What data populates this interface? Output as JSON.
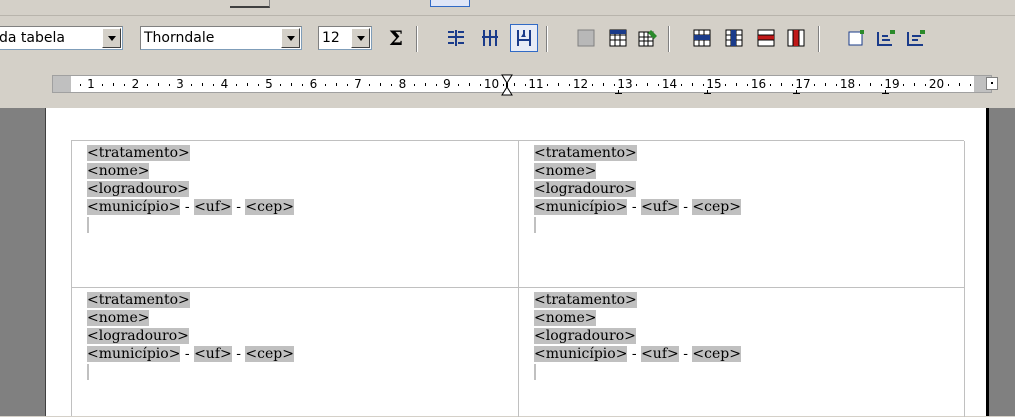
{
  "toolbar": {
    "table_style": "da tabela",
    "font_name": "Thorndale",
    "font_size": "12",
    "autosum_symbol": "Σ"
  },
  "ruler": {
    "numbers": [
      "1",
      "2",
      "3",
      "4",
      "5",
      "6",
      "7",
      "8",
      "9",
      "10",
      "11",
      "12",
      "13",
      "14",
      "15",
      "16",
      "17",
      "18",
      "19",
      "20"
    ]
  },
  "labels": [
    {
      "line1": "<tratamento>",
      "line2": "<nome>",
      "line3": "<logradouro>",
      "municipio": "<município>",
      "sep": " - ",
      "uf": "<uf>",
      "cep": "<cep>"
    },
    {
      "line1": "<tratamento>",
      "line2": "<nome>",
      "line3": "<logradouro>",
      "municipio": "<município>",
      "sep": " - ",
      "uf": "<uf>",
      "cep": "<cep>"
    },
    {
      "line1": "<tratamento>",
      "line2": "<nome>",
      "line3": "<logradouro>",
      "municipio": "<município>",
      "sep": " - ",
      "uf": "<uf>",
      "cep": "<cep>"
    },
    {
      "line1": "<tratamento>",
      "line2": "<nome>",
      "line3": "<logradouro>",
      "municipio": "<município>",
      "sep": " - ",
      "uf": "<uf>",
      "cep": "<cep>"
    }
  ]
}
